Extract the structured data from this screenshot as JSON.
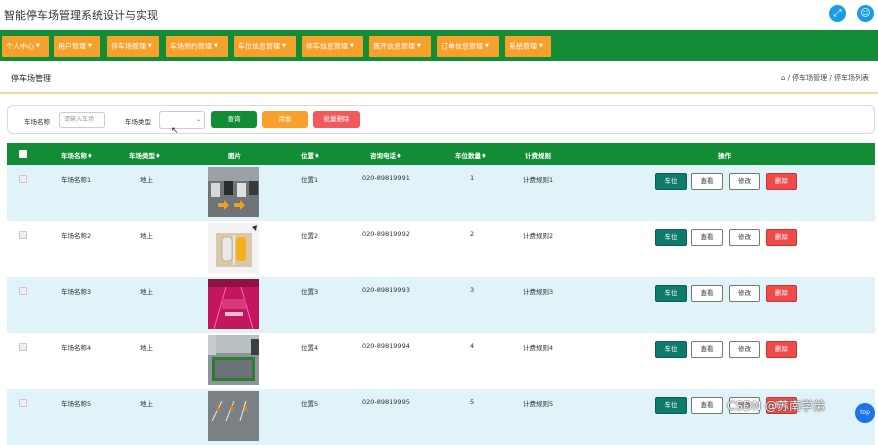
{
  "app": {
    "title": "智能停车场管理系统设计与实现",
    "expand_icon": "expand-icon",
    "user_icon": "user-avatar-icon"
  },
  "nav": {
    "items": [
      {
        "label": "个人中心"
      },
      {
        "label": "用户管理"
      },
      {
        "label": "停车场管理"
      },
      {
        "label": "车场预约管理"
      },
      {
        "label": "车位信息管理"
      },
      {
        "label": "停车信息管理"
      },
      {
        "label": "离开信息管理"
      },
      {
        "label": "订单信息管理"
      },
      {
        "label": "系统管理"
      }
    ]
  },
  "page": {
    "title": "停车场管理",
    "breadcrumb": "/ 停车场管理 / 停车场列表",
    "home_icon": "home-icon"
  },
  "search": {
    "name_label": "车场名称",
    "name_placeholder": "请输入车场",
    "type_label": "车场类型",
    "type_value": "",
    "query_label": "查询",
    "add_label": "添加",
    "batch_delete_label": "批量删除"
  },
  "table": {
    "headers": {
      "name": "车场名称♦",
      "type": "车场类型♦",
      "image": "图片",
      "location": "位置♦",
      "phone": "咨询电话♦",
      "count": "车位数量♦",
      "rule": "计费规则",
      "actions": "操作"
    },
    "action_labels": {
      "spaces": "车位",
      "view": "查看",
      "edit": "修改",
      "delete": "删除"
    },
    "rows": [
      {
        "name": "车场名称1",
        "type": "地上",
        "location": "位置1",
        "phone": "020-89819991",
        "count": "1",
        "rule": "计费规则1"
      },
      {
        "name": "车场名称2",
        "type": "地上",
        "location": "位置2",
        "phone": "020-89819992",
        "count": "2",
        "rule": "计费规则2"
      },
      {
        "name": "车场名称3",
        "type": "地上",
        "location": "位置3",
        "phone": "020-89819993",
        "count": "3",
        "rule": "计费规则3"
      },
      {
        "name": "车场名称4",
        "type": "地上",
        "location": "位置4",
        "phone": "020-89819994",
        "count": "4",
        "rule": "计费规则4"
      },
      {
        "name": "车场名称5",
        "type": "地上",
        "location": "位置5",
        "phone": "020-89819995",
        "count": "5",
        "rule": "计费规则5"
      }
    ]
  },
  "watermark": "CSDN @苏南学弟",
  "colors": {
    "primary_green": "#128d36",
    "nav_orange": "#f7a12c",
    "danger_red": "#f05a5a",
    "row_alt": "#dff3f8",
    "icon_blue": "#1a9be6"
  }
}
